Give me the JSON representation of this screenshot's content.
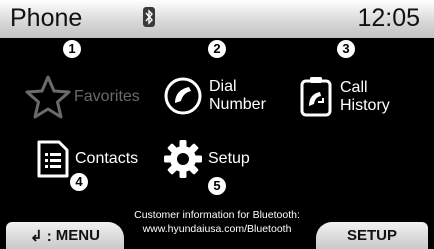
{
  "header": {
    "title": "Phone",
    "time": "12:05",
    "status_icon": "bluetooth-icon"
  },
  "menu": {
    "favorites": {
      "label": "Favorites",
      "number": "1",
      "icon": "star-icon"
    },
    "dial": {
      "label_line1": "Dial",
      "label_line2": "Number",
      "number": "2",
      "icon": "phone-handset-icon"
    },
    "history": {
      "label_line1": "Call",
      "label_line2": "History",
      "number": "3",
      "icon": "call-history-icon"
    },
    "contacts": {
      "label": "Contacts",
      "number": "4",
      "icon": "contacts-list-icon"
    },
    "setup": {
      "label": "Setup",
      "number": "5",
      "icon": "gear-icon"
    }
  },
  "info": {
    "line1": "Customer information for Bluetooth:",
    "line2": "www.hyundaiusa.com/Bluetooth"
  },
  "buttons": {
    "menu_label": "MENU",
    "menu_prefix": "↲ :",
    "setup_label": "SETUP"
  },
  "colors": {
    "background": "#000000",
    "disabled_text": "#6a6a6a",
    "button_bg": "#dcdcdc"
  }
}
